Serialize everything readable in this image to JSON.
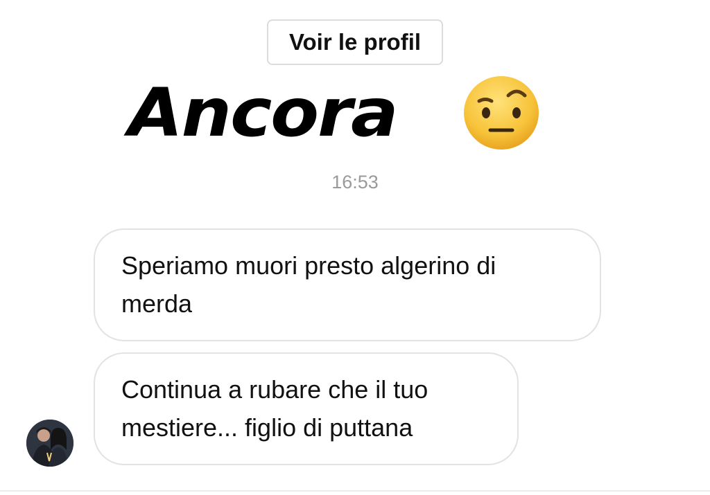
{
  "header": {
    "view_profile_label": "Voir le profil"
  },
  "sticker": {
    "text": "Ancora",
    "emoji": "face-with-raised-eyebrow"
  },
  "timestamp": "16:53",
  "messages": [
    {
      "lines": [
        "Speriamo muori presto algerino di",
        "merda"
      ]
    },
    {
      "lines": [
        "Continua a rubare che il tuo",
        "mestiere... figlio di puttana"
      ]
    }
  ],
  "sender": {
    "avatar_icon": "profile-photo"
  },
  "colors": {
    "bubble_border": "#e2e2e2",
    "timestamp": "#9a9a9a",
    "emoji_yellow": "#f7c33a"
  }
}
